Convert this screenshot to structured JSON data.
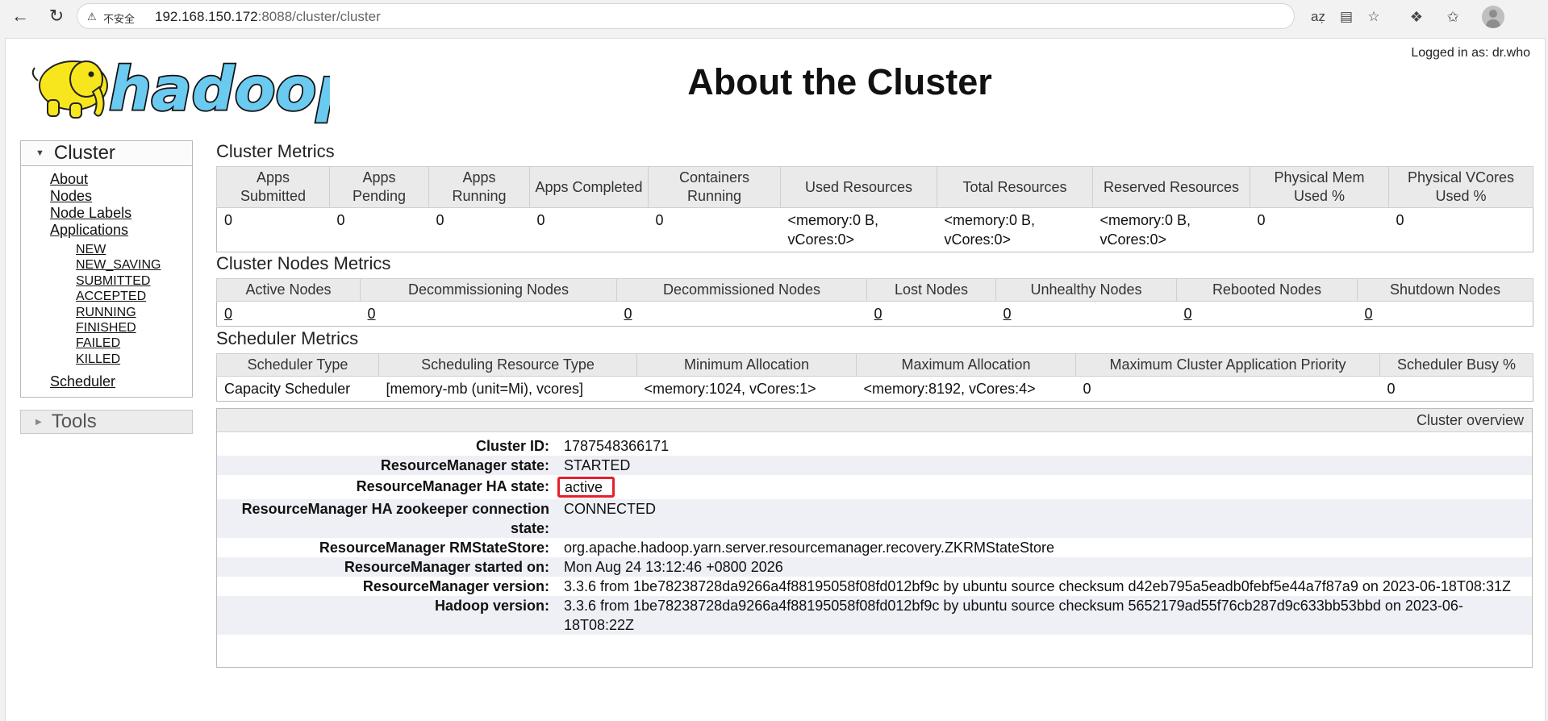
{
  "browser": {
    "insecure_label": "不安全",
    "url_host": "192.168.150.172",
    "url_rest": ":8088/cluster/cluster"
  },
  "header": {
    "logo_text": "hadoop",
    "title": "About the Cluster",
    "logged_in": "Logged in as: dr.who"
  },
  "sidebar": {
    "cluster_heading": "Cluster",
    "links": [
      "About",
      "Nodes",
      "Node Labels",
      "Applications"
    ],
    "app_states": [
      "NEW",
      "NEW_SAVING",
      "SUBMITTED",
      "ACCEPTED",
      "RUNNING",
      "FINISHED",
      "FAILED",
      "KILLED"
    ],
    "scheduler": "Scheduler",
    "tools_heading": "Tools"
  },
  "cluster_metrics": {
    "title": "Cluster Metrics",
    "headers": [
      "Apps Submitted",
      "Apps Pending",
      "Apps Running",
      "Apps Completed",
      "Containers Running",
      "Used Resources",
      "Total Resources",
      "Reserved Resources",
      "Physical Mem Used %",
      "Physical VCores Used %"
    ],
    "values": [
      "0",
      "0",
      "0",
      "0",
      "0",
      "<memory:0 B, vCores:0>",
      "<memory:0 B, vCores:0>",
      "<memory:0 B, vCores:0>",
      "0",
      "0"
    ]
  },
  "nodes_metrics": {
    "title": "Cluster Nodes Metrics",
    "headers": [
      "Active Nodes",
      "Decommissioning Nodes",
      "Decommissioned Nodes",
      "Lost Nodes",
      "Unhealthy Nodes",
      "Rebooted Nodes",
      "Shutdown Nodes"
    ],
    "values": [
      "0",
      "0",
      "0",
      "0",
      "0",
      "0",
      "0"
    ]
  },
  "scheduler_metrics": {
    "title": "Scheduler Metrics",
    "headers": [
      "Scheduler Type",
      "Scheduling Resource Type",
      "Minimum Allocation",
      "Maximum Allocation",
      "Maximum Cluster Application Priority",
      "Scheduler Busy %"
    ],
    "values": [
      "Capacity Scheduler",
      "[memory-mb (unit=Mi), vcores]",
      "<memory:1024, vCores:1>",
      "<memory:8192, vCores:4>",
      "0",
      "0"
    ]
  },
  "overview": {
    "heading": "Cluster overview",
    "rows": [
      {
        "label": "Cluster ID:",
        "value": "1787548366171"
      },
      {
        "label": "ResourceManager state:",
        "value": "STARTED"
      },
      {
        "label": "ResourceManager HA state:",
        "value": "active"
      },
      {
        "label": "ResourceManager HA zookeeper connection state:",
        "value": "CONNECTED"
      },
      {
        "label": "ResourceManager RMStateStore:",
        "value": "org.apache.hadoop.yarn.server.resourcemanager.recovery.ZKRMStateStore"
      },
      {
        "label": "ResourceManager started on:",
        "value": "Mon Aug 24 13:12:46 +0800 2026"
      },
      {
        "label": "ResourceManager version:",
        "value": "3.3.6 from 1be78238728da9266a4f88195058f08fd012bf9c by ubuntu source checksum d42eb795a5eadb0febf5e44a7f87a9 on 2023-06-18T08:31Z"
      },
      {
        "label": "Hadoop version:",
        "value": "3.3.6 from 1be78238728da9266a4f88195058f08fd012bf9c by ubuntu source checksum 5652179ad55f76cb287d9c633bb53bbd on 2023-06-18T08:22Z"
      }
    ]
  },
  "colors": {
    "highlight_box": "#e5202a",
    "logo_yellow": "#f8e61c",
    "logo_blue": "#6bcaf0"
  }
}
